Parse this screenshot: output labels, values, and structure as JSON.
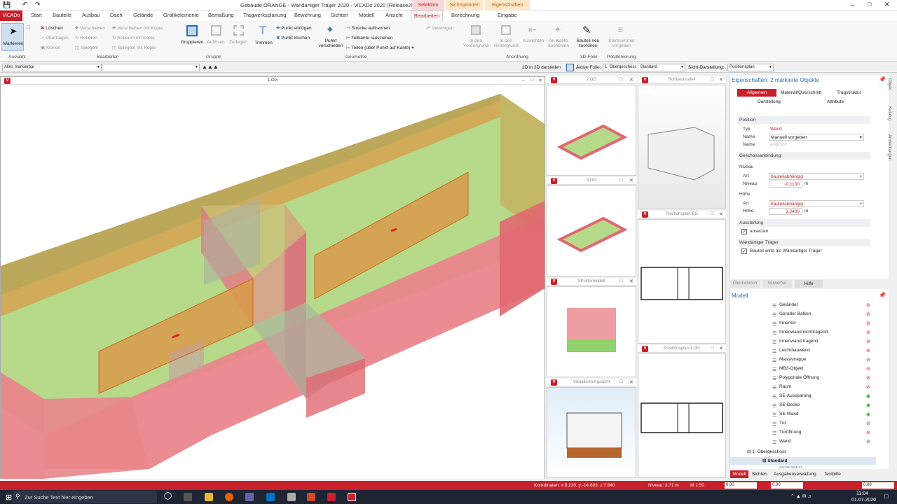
{
  "window": {
    "title": "Gebäude ORANGE - Wandartiger Träger 2020 - ViCADo 2020 (Release2020)"
  },
  "context_tabs": [
    "Selektion",
    "Sichtoptionen",
    "Eigenschaften"
  ],
  "app_tab": "ViCADo",
  "tabs": [
    "Start",
    "Bauteile",
    "Ausbau",
    "Dach",
    "Gelände",
    "Grafikelemente",
    "Bemaßung",
    "Tragwerksplanung",
    "Bewehrung",
    "Sichten",
    "Modell",
    "Ansicht",
    "Bearbeiten",
    "Berechnung",
    "Eingabe"
  ],
  "ribbon": {
    "auswahl": {
      "label": "Auswahl",
      "markieren": "Markieren"
    },
    "bearbeiten": {
      "label": "Bearbeiten",
      "loeschen": "Löschen",
      "uebertragen": "Übertragen",
      "klonen": "Klonen",
      "verschieben": "Verschieben",
      "rotieren": "Rotieren",
      "spiegeln": "Spiegeln",
      "verschieben_kopie": "Verschieben mit Kopie",
      "rotieren_kopie": "Rotieren mit Kopie",
      "spiegeln_kopie": "Spiegeln mit Kopie"
    },
    "gruppe": {
      "label": "Gruppe",
      "gruppieren": "Gruppieren",
      "aufloesen": "Auflösen",
      "zerlegen": "Zerlegen"
    },
    "geometrie": {
      "label": "Geometrie",
      "trimmen": "Trimmen",
      "punkt_einfuegen": "Punkt einfügen",
      "punkt_loeschen": "Punkt löschen",
      "punkt_verschieben": "Punkt verschieben",
      "strecke_aufrennen": "Strecke auftrennen",
      "teilkante": "Teilkante rausziehen",
      "teilen": "Teilen (über Punkt auf Kante)"
    },
    "anordnung": {
      "label": "Anordnung",
      "vereinigen": "Vereinigen",
      "vordergrund": "In den Vordergrund",
      "hintergrund": "In den Hintergrund",
      "ausrichten": "Ausrichten",
      "an_kante": "An Kante ausrichten"
    },
    "folie": {
      "label": "3D-Folie",
      "neu_zuordnen": "Bauteil neu zuordnen"
    },
    "positionierung": {
      "label": "Positionierung",
      "startnummer": "Startnummer vorgeben"
    }
  },
  "optbar": {
    "filter": "Alles markierbar",
    "show2d": "2D in 3D darstellen",
    "folie_label": "Aktive Folie:",
    "folie_value": "1. Obergeschoss : Standard",
    "sicht_label": "Sicht-Darstellung:",
    "sicht_value": "Positionsplan"
  },
  "views": {
    "main": "1.OG",
    "og2": "2.OG",
    "og3": "3.OG",
    "struktur": "Strukturmodell",
    "visual": "Visualisierungssicht",
    "rohbau": "Rohbaumodell",
    "pos_eg": "Positionsplan EG",
    "pos_1og": "Positionsplan 1.OG"
  },
  "props": {
    "title": "Eigenschaften: 2 markierte Objekte",
    "tabs": [
      "Allgemein",
      "Material/Querschnitt",
      "Tragstruktur",
      "Darstellung",
      "Attribute"
    ],
    "position": "Position",
    "typ_label": "Typ",
    "typ_value": "Wand",
    "name_label": "Name",
    "name_value": "Manuell vorgeben",
    "name2_label": "Name",
    "name2_placeholder": "englisch",
    "geschoss": "Geschossanbindung",
    "niveau": "Niveau",
    "art_label": "Art",
    "art_value": "bauteilabhängig",
    "niveau_label": "Niveau",
    "niveau_value": "-0.1100",
    "unit_m": "m",
    "hoehe": "Höhe",
    "art2_value": "bauteilabhängig",
    "hoehe_label": "Höhe",
    "hoehe_value": "3.2400",
    "aussteifung": "Aussteifung",
    "ansetzen": "ansetzen",
    "wandartig": "Wandartiger Träger",
    "wirkt": "Bauteil wirkt als Wandartiger Träger",
    "buttons": [
      "Übernehmen",
      "Verwerfen",
      "Hilfe"
    ]
  },
  "side_tabs": [
    "Objekt",
    "Katalog",
    "Anmerkungen"
  ],
  "tree": {
    "title": "Modell",
    "items": [
      "Geländer",
      "Gerader Balken",
      "Innentür",
      "Innenwand nichttragend",
      "Innenwand tragend",
      "Leichtbauwand",
      "Massivtreppe",
      "MB3-Objekt",
      "Polygonale Öffnung",
      "Raum",
      "SE-Aussparung",
      "SE-Decke",
      "SE-Wand",
      "Tür",
      "Türöffnung",
      "Wand"
    ],
    "folder": "1. Obergeschoss",
    "standard": "Standard",
    "cut": "Außenwand",
    "bottom_tabs": [
      "Modell",
      "Sichten",
      "Ausgabenverwaltung",
      "Texthilfe"
    ]
  },
  "status": {
    "coords": "Koordinaten: x:9.220, y:-14.683, z:7.840",
    "niveau": "Niveau: 3.71 m",
    "scale": "M 1:50",
    "dx": "0.00",
    "dy": "0.00",
    "dz": "0.00"
  },
  "taskbar": {
    "search": "Zur Suche Text hier eingeben",
    "time": "11:04",
    "date": "01.07.2020"
  },
  "colors": {
    "accent": "#c8202a",
    "floor": "#b6d98a",
    "wall_red": "#e9868b",
    "wall_orange": "#d99a4a"
  }
}
